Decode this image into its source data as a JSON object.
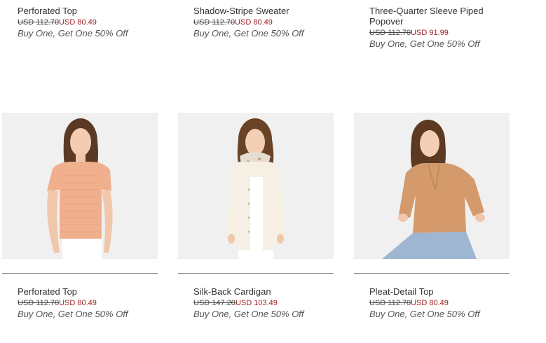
{
  "top_row": [
    {
      "name": "Perforated Top",
      "old_price": "USD 112.70",
      "new_price": "USD 80.49",
      "promo": "Buy One, Get One 50% Off"
    },
    {
      "name": "Shadow-Stripe Sweater",
      "old_price": "USD 112.70",
      "new_price": "USD 80.49",
      "promo": "Buy One, Get One 50% Off"
    },
    {
      "name": "Three-Quarter Sleeve Piped Popover",
      "old_price": "USD 112.70",
      "new_price": "USD 91.99",
      "promo": "Buy One, Get One 50% Off"
    }
  ],
  "bottom_row": [
    {
      "name": "Perforated Top",
      "old_price": "USD 112.70",
      "new_price": "USD 80.49",
      "promo": "Buy One, Get One 50% Off",
      "garment_color": "#f0b08e"
    },
    {
      "name": "Silk-Back Cardigan",
      "old_price": "USD 147.20",
      "new_price": "USD 103.49",
      "promo": "Buy One, Get One 50% Off",
      "garment_color": "#f5efe4"
    },
    {
      "name": "Pleat-Detail Top",
      "old_price": "USD 112.70",
      "new_price": "USD 80.49",
      "promo": "Buy One, Get One 50% Off",
      "garment_color": "#d49a6c"
    }
  ],
  "colors": {
    "sale_price": "#9b1b1b",
    "divider": "#8a8a8a",
    "photo_bg": "#f0f0f0"
  }
}
